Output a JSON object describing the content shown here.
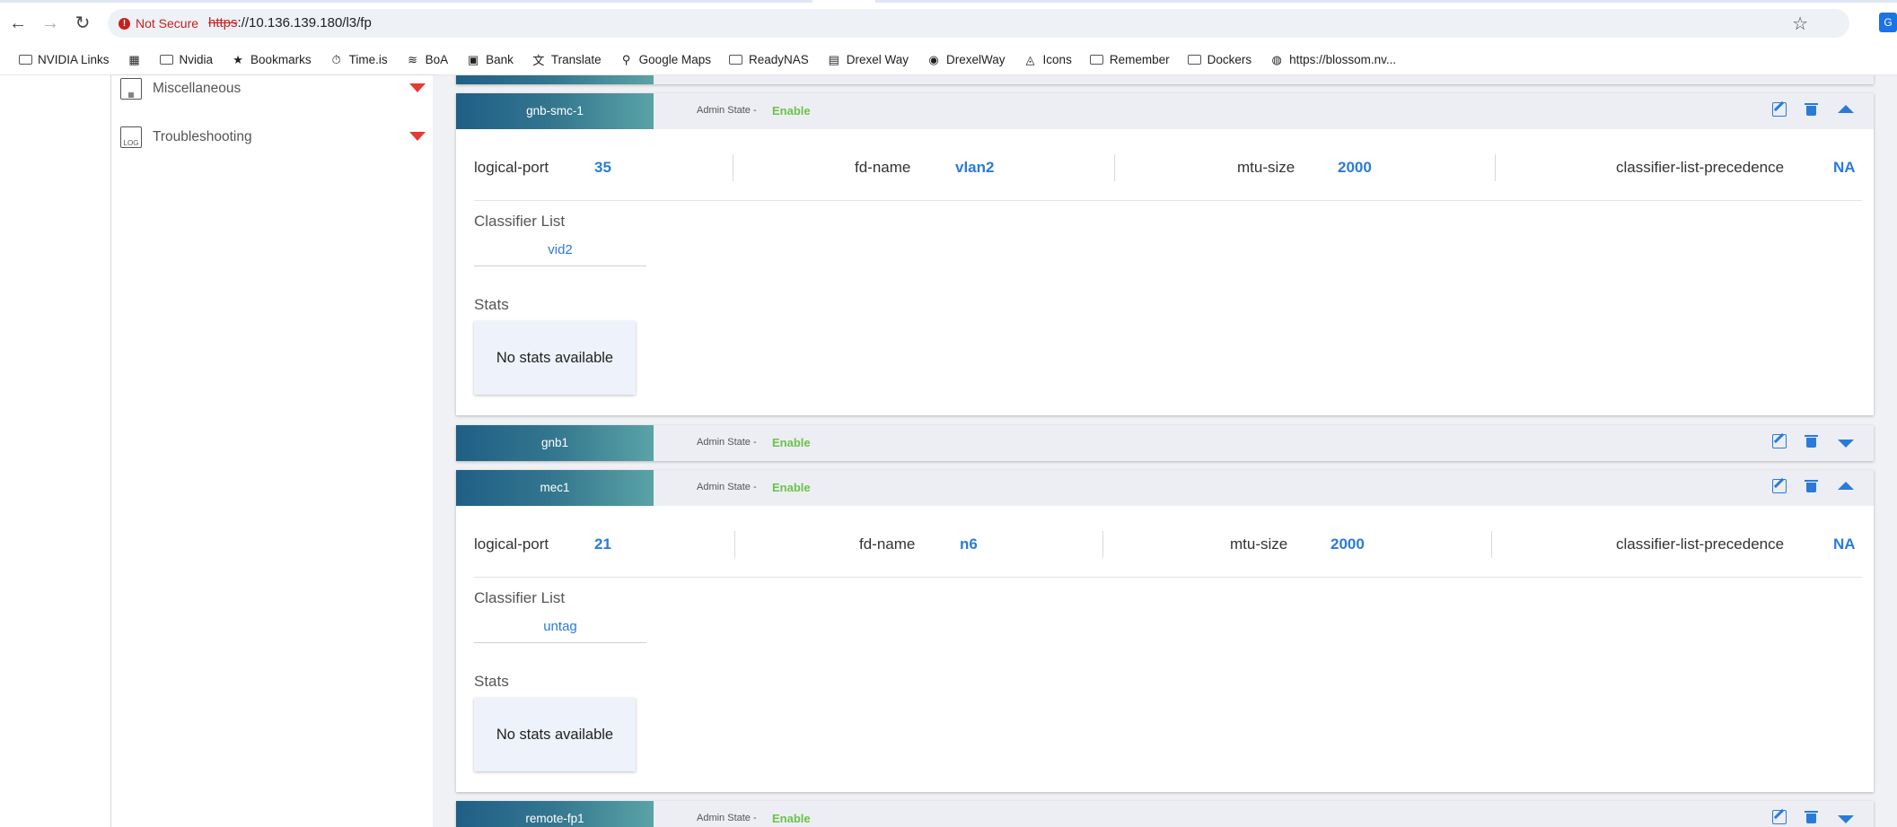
{
  "browser": {
    "not_secure": "Not Secure",
    "url_scheme": "https",
    "url_rest": "://10.136.139.180/l3/fp",
    "bookmarks": [
      {
        "label": "NVIDIA Links",
        "icon": "folder-icon"
      },
      {
        "label": "",
        "icon": "apps-grid-icon"
      },
      {
        "label": "Nvidia",
        "icon": "folder-icon"
      },
      {
        "label": "Bookmarks",
        "icon": "star-icon"
      },
      {
        "label": "Time.is",
        "icon": "timeis-icon"
      },
      {
        "label": "BoA",
        "icon": "boa-icon"
      },
      {
        "label": "Bank",
        "icon": "bank-icon"
      },
      {
        "label": "Translate",
        "icon": "translate-icon"
      },
      {
        "label": "Google Maps",
        "icon": "maps-pin-icon"
      },
      {
        "label": "ReadyNAS",
        "icon": "folder-icon"
      },
      {
        "label": "Drexel Way",
        "icon": "drexel-icon"
      },
      {
        "label": "DrexelWay",
        "icon": "wifi-icon"
      },
      {
        "label": "Icons",
        "icon": "icons-icon"
      },
      {
        "label": "Remember",
        "icon": "folder-icon"
      },
      {
        "label": "Dockers",
        "icon": "folder-icon"
      },
      {
        "label": "https://blossom.nv...",
        "icon": "globe-icon"
      }
    ]
  },
  "sidebar": {
    "items": [
      {
        "label": "Miscellaneous",
        "icon": "calendar-grid-icon"
      },
      {
        "label": "Troubleshooting",
        "icon": "log-icon"
      }
    ],
    "caret_color": "#e53935"
  },
  "labels": {
    "admin_state": "Admin State -",
    "classifier_list": "Classifier List",
    "stats": "Stats",
    "no_stats": "No stats available",
    "logical_port": "logical-port",
    "fd_name": "fd-name",
    "mtu_size": "mtu-size",
    "clp": "classifier-list-precedence"
  },
  "panels": [
    {
      "name": "gnb-smc-1",
      "admin_state": "Enable",
      "expanded": true,
      "logical_port": "35",
      "fd_name": "vlan2",
      "mtu_size": "2000",
      "classifier_list_precedence": "NA",
      "classifiers": [
        "vid2"
      ]
    },
    {
      "name": "gnb1",
      "admin_state": "Enable",
      "expanded": false
    },
    {
      "name": "mec1",
      "admin_state": "Enable",
      "expanded": true,
      "logical_port": "21",
      "fd_name": "n6",
      "mtu_size": "2000",
      "classifier_list_precedence": "NA",
      "classifiers": [
        "untag"
      ]
    },
    {
      "name": "remote-fp1",
      "admin_state": "Enable",
      "expanded": false
    }
  ],
  "colors": {
    "accent": "#2a7bd8",
    "enable": "#6cc24a",
    "header_gradient_start": "#1f5f86",
    "header_gradient_end": "#5aa3a6"
  }
}
